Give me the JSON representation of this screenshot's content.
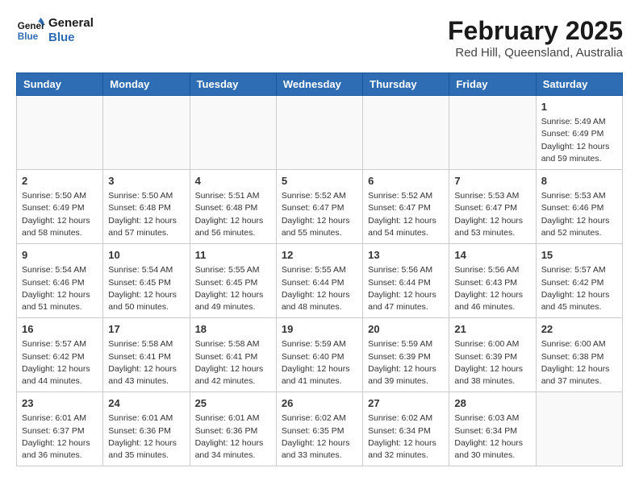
{
  "header": {
    "logo_line1": "General",
    "logo_line2": "Blue",
    "month": "February 2025",
    "location": "Red Hill, Queensland, Australia"
  },
  "days_of_week": [
    "Sunday",
    "Monday",
    "Tuesday",
    "Wednesday",
    "Thursday",
    "Friday",
    "Saturday"
  ],
  "weeks": [
    [
      {
        "day": "",
        "info": ""
      },
      {
        "day": "",
        "info": ""
      },
      {
        "day": "",
        "info": ""
      },
      {
        "day": "",
        "info": ""
      },
      {
        "day": "",
        "info": ""
      },
      {
        "day": "",
        "info": ""
      },
      {
        "day": "1",
        "info": "Sunrise: 5:49 AM\nSunset: 6:49 PM\nDaylight: 12 hours\nand 59 minutes."
      }
    ],
    [
      {
        "day": "2",
        "info": "Sunrise: 5:50 AM\nSunset: 6:49 PM\nDaylight: 12 hours\nand 58 minutes."
      },
      {
        "day": "3",
        "info": "Sunrise: 5:50 AM\nSunset: 6:48 PM\nDaylight: 12 hours\nand 57 minutes."
      },
      {
        "day": "4",
        "info": "Sunrise: 5:51 AM\nSunset: 6:48 PM\nDaylight: 12 hours\nand 56 minutes."
      },
      {
        "day": "5",
        "info": "Sunrise: 5:52 AM\nSunset: 6:47 PM\nDaylight: 12 hours\nand 55 minutes."
      },
      {
        "day": "6",
        "info": "Sunrise: 5:52 AM\nSunset: 6:47 PM\nDaylight: 12 hours\nand 54 minutes."
      },
      {
        "day": "7",
        "info": "Sunrise: 5:53 AM\nSunset: 6:47 PM\nDaylight: 12 hours\nand 53 minutes."
      },
      {
        "day": "8",
        "info": "Sunrise: 5:53 AM\nSunset: 6:46 PM\nDaylight: 12 hours\nand 52 minutes."
      }
    ],
    [
      {
        "day": "9",
        "info": "Sunrise: 5:54 AM\nSunset: 6:46 PM\nDaylight: 12 hours\nand 51 minutes."
      },
      {
        "day": "10",
        "info": "Sunrise: 5:54 AM\nSunset: 6:45 PM\nDaylight: 12 hours\nand 50 minutes."
      },
      {
        "day": "11",
        "info": "Sunrise: 5:55 AM\nSunset: 6:45 PM\nDaylight: 12 hours\nand 49 minutes."
      },
      {
        "day": "12",
        "info": "Sunrise: 5:55 AM\nSunset: 6:44 PM\nDaylight: 12 hours\nand 48 minutes."
      },
      {
        "day": "13",
        "info": "Sunrise: 5:56 AM\nSunset: 6:44 PM\nDaylight: 12 hours\nand 47 minutes."
      },
      {
        "day": "14",
        "info": "Sunrise: 5:56 AM\nSunset: 6:43 PM\nDaylight: 12 hours\nand 46 minutes."
      },
      {
        "day": "15",
        "info": "Sunrise: 5:57 AM\nSunset: 6:42 PM\nDaylight: 12 hours\nand 45 minutes."
      }
    ],
    [
      {
        "day": "16",
        "info": "Sunrise: 5:57 AM\nSunset: 6:42 PM\nDaylight: 12 hours\nand 44 minutes."
      },
      {
        "day": "17",
        "info": "Sunrise: 5:58 AM\nSunset: 6:41 PM\nDaylight: 12 hours\nand 43 minutes."
      },
      {
        "day": "18",
        "info": "Sunrise: 5:58 AM\nSunset: 6:41 PM\nDaylight: 12 hours\nand 42 minutes."
      },
      {
        "day": "19",
        "info": "Sunrise: 5:59 AM\nSunset: 6:40 PM\nDaylight: 12 hours\nand 41 minutes."
      },
      {
        "day": "20",
        "info": "Sunrise: 5:59 AM\nSunset: 6:39 PM\nDaylight: 12 hours\nand 39 minutes."
      },
      {
        "day": "21",
        "info": "Sunrise: 6:00 AM\nSunset: 6:39 PM\nDaylight: 12 hours\nand 38 minutes."
      },
      {
        "day": "22",
        "info": "Sunrise: 6:00 AM\nSunset: 6:38 PM\nDaylight: 12 hours\nand 37 minutes."
      }
    ],
    [
      {
        "day": "23",
        "info": "Sunrise: 6:01 AM\nSunset: 6:37 PM\nDaylight: 12 hours\nand 36 minutes."
      },
      {
        "day": "24",
        "info": "Sunrise: 6:01 AM\nSunset: 6:36 PM\nDaylight: 12 hours\nand 35 minutes."
      },
      {
        "day": "25",
        "info": "Sunrise: 6:01 AM\nSunset: 6:36 PM\nDaylight: 12 hours\nand 34 minutes."
      },
      {
        "day": "26",
        "info": "Sunrise: 6:02 AM\nSunset: 6:35 PM\nDaylight: 12 hours\nand 33 minutes."
      },
      {
        "day": "27",
        "info": "Sunrise: 6:02 AM\nSunset: 6:34 PM\nDaylight: 12 hours\nand 32 minutes."
      },
      {
        "day": "28",
        "info": "Sunrise: 6:03 AM\nSunset: 6:34 PM\nDaylight: 12 hours\nand 30 minutes."
      },
      {
        "day": "",
        "info": ""
      }
    ]
  ]
}
